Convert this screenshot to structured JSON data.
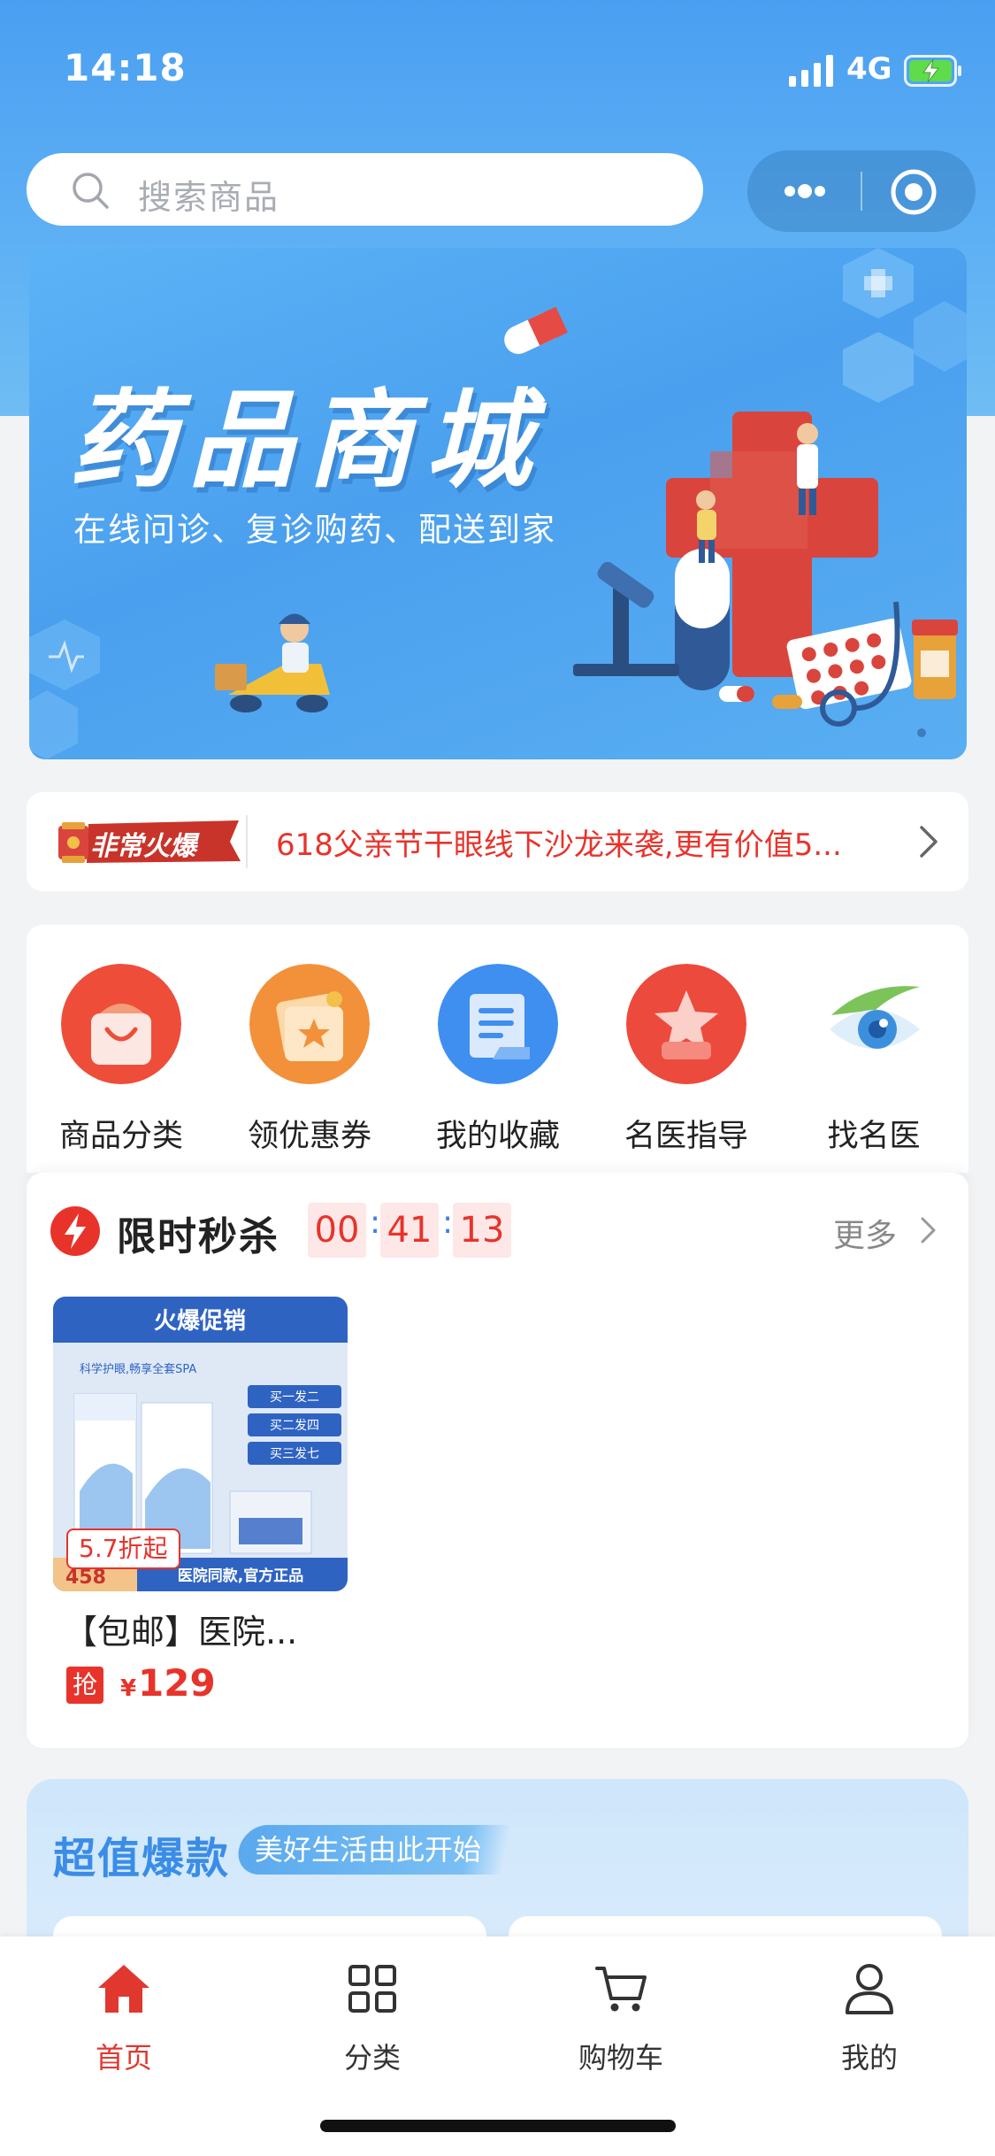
{
  "status_bar": {
    "time": "14:18",
    "network": "4G"
  },
  "search": {
    "placeholder": "搜索商品"
  },
  "banner": {
    "title": "药品商城",
    "subtitle": "在线问诊、复诊购药、配送到家"
  },
  "notice": {
    "badge": "非常火爆",
    "text": "618父亲节干眼线下沙龙来袭,更有价值5..."
  },
  "menu": {
    "items": [
      {
        "label": "商品分类",
        "icon": "shopping-bag-icon",
        "color": "#ee4d3a"
      },
      {
        "label": "领优惠券",
        "icon": "coupon-icon",
        "color": "#f2913a"
      },
      {
        "label": "我的收藏",
        "icon": "document-icon",
        "color": "#3e8ff0"
      },
      {
        "label": "名医指导",
        "icon": "doctor-star-icon",
        "color": "#ec4a3c"
      },
      {
        "label": "找名医",
        "icon": "eye-icon",
        "color": "#3c8fdc"
      }
    ]
  },
  "flash_sale": {
    "title": "限时秒杀",
    "timer": {
      "hours": "00",
      "minutes": "41",
      "seconds": "13"
    },
    "more": "更多",
    "products": [
      {
        "name": "【包邮】医院...",
        "discount": "5.7折起",
        "grab_label": "抢",
        "currency": "¥",
        "price": "129",
        "image_text": {
          "headline": "火爆促销",
          "line1": "科学护眼,畅享全套SPA",
          "offer1": "买一发二",
          "offer2": "买二发四",
          "offer3": "买三发七",
          "footer": "医院同款,官方正品",
          "corner": "458"
        }
      }
    ]
  },
  "super_value": {
    "title": "超值爆款",
    "tag": "美好生活由此开始"
  },
  "tab_bar": {
    "items": [
      {
        "label": "首页",
        "icon": "home-icon",
        "active": true
      },
      {
        "label": "分类",
        "icon": "grid-icon",
        "active": false
      },
      {
        "label": "购物车",
        "icon": "cart-icon",
        "active": false
      },
      {
        "label": "我的",
        "icon": "user-icon",
        "active": false
      }
    ]
  },
  "colors": {
    "brand_blue": "#4a9ff2",
    "accent_red": "#e8332b",
    "tab_active": "#e0382f"
  }
}
